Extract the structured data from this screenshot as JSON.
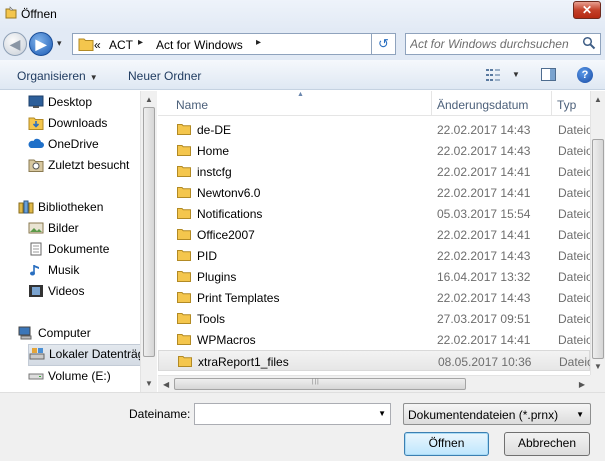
{
  "window": {
    "title": "Öffnen",
    "close_glyph": "✕"
  },
  "navigation": {
    "back_glyph": "◀",
    "forward_glyph": "▶",
    "history_glyph": "▾"
  },
  "address": {
    "overflow": "«",
    "crumbs": [
      "ACT",
      "Act for Windows"
    ],
    "separator": "▸",
    "refresh_glyph": "↺"
  },
  "search": {
    "placeholder": "Act for Windows durchsuchen"
  },
  "toolbar": {
    "organize_label": "Organisieren",
    "new_folder_label": "Neuer Ordner",
    "help_label": "?",
    "dropdown_glyph": "▼"
  },
  "nav_pane": {
    "items": [
      {
        "label": "Desktop",
        "icon": "desktop-icon"
      },
      {
        "label": "Downloads",
        "icon": "downloads-folder-icon"
      },
      {
        "label": "OneDrive",
        "icon": "onedrive-cloud-icon"
      },
      {
        "label": "Zuletzt besucht",
        "icon": "recent-places-icon"
      },
      {
        "label": "Bibliotheken",
        "icon": "libraries-icon"
      },
      {
        "label": "Bilder",
        "icon": "pictures-icon"
      },
      {
        "label": "Dokumente",
        "icon": "documents-icon"
      },
      {
        "label": "Musik",
        "icon": "music-icon"
      },
      {
        "label": "Videos",
        "icon": "videos-icon"
      },
      {
        "label": "Computer",
        "icon": "computer-icon"
      },
      {
        "label": "Lokaler Datenträger",
        "icon": "local-disk-icon",
        "selected": true
      },
      {
        "label": "Volume (E:)",
        "icon": "drive-icon"
      }
    ]
  },
  "file_list": {
    "columns": {
      "name": "Name",
      "date": "Änderungsdatum",
      "type": "Typ"
    },
    "sort_glyph": "▲",
    "rows": [
      {
        "name": "de-DE",
        "date": "22.02.2017 14:43",
        "type": "Dateio"
      },
      {
        "name": "Home",
        "date": "22.02.2017 14:43",
        "type": "Dateio"
      },
      {
        "name": "instcfg",
        "date": "22.02.2017 14:41",
        "type": "Dateio"
      },
      {
        "name": "Newtonv6.0",
        "date": "22.02.2017 14:41",
        "type": "Dateio"
      },
      {
        "name": "Notifications",
        "date": "05.03.2017 15:54",
        "type": "Dateio"
      },
      {
        "name": "Office2007",
        "date": "22.02.2017 14:41",
        "type": "Dateio"
      },
      {
        "name": "PID",
        "date": "22.02.2017 14:43",
        "type": "Dateio"
      },
      {
        "name": "Plugins",
        "date": "16.04.2017 13:32",
        "type": "Dateio"
      },
      {
        "name": "Print Templates",
        "date": "22.02.2017 14:43",
        "type": "Dateio"
      },
      {
        "name": "Tools",
        "date": "27.03.2017 09:51",
        "type": "Dateio"
      },
      {
        "name": "WPMacros",
        "date": "22.02.2017 14:41",
        "type": "Dateio"
      },
      {
        "name": "xtraReport1_files",
        "date": "08.05.2017 10:36",
        "type": "Dateio",
        "selected": true
      }
    ]
  },
  "scroll": {
    "up": "▲",
    "down": "▼",
    "left": "◀",
    "right": "▶",
    "grip": "|||"
  },
  "bottom": {
    "filename_label": "Dateiname:",
    "filename_value": "",
    "filetype_selected": "Dokumentendateien (*.prnx)",
    "open_label": "Öffnen",
    "cancel_label": "Abbrechen",
    "dropdown_glyph": "▼"
  },
  "colors": {
    "folder": "#f4c64d",
    "accent": "#1b5bb5",
    "close": "#c4412a"
  }
}
